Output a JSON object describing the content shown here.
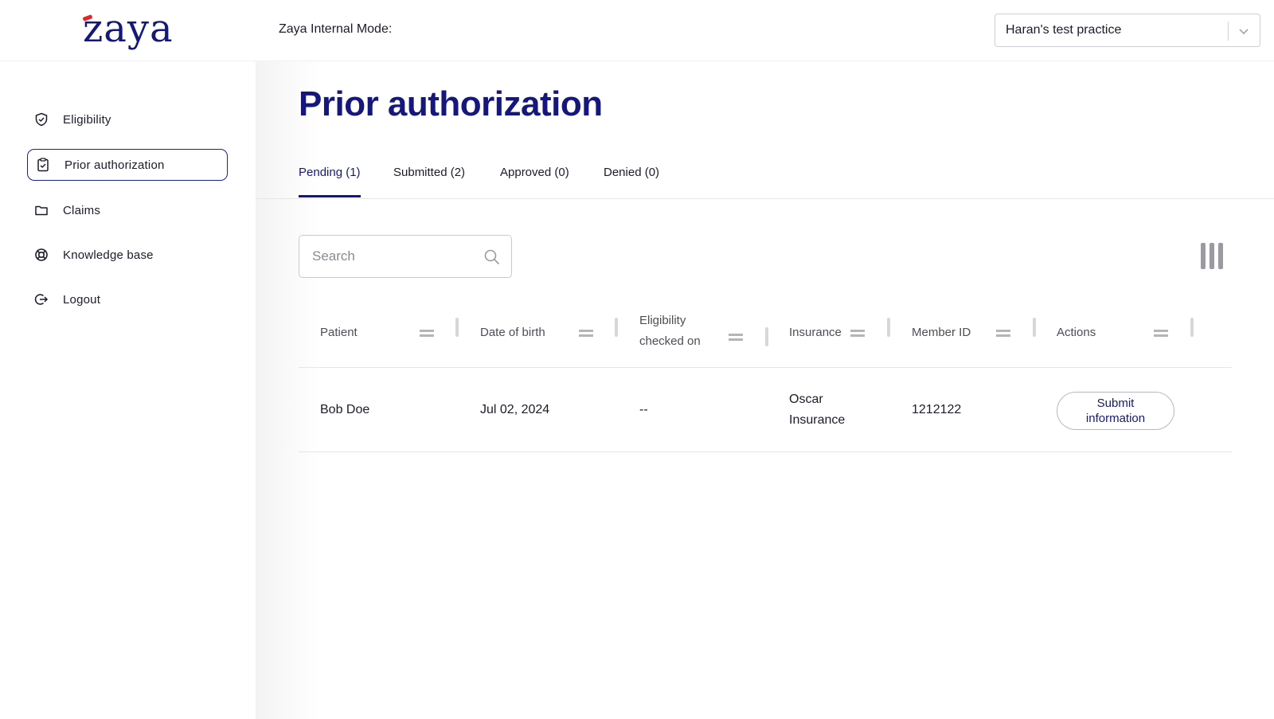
{
  "brand": {
    "logo_text": "zaya"
  },
  "sidebar": {
    "items": [
      {
        "label": "Eligibility",
        "icon": "shield-check-icon",
        "active": false
      },
      {
        "label": "Prior authorization",
        "icon": "clipboard-check-icon",
        "active": true
      },
      {
        "label": "Claims",
        "icon": "folder-icon",
        "active": false
      },
      {
        "label": "Knowledge base",
        "icon": "lifebuoy-icon",
        "active": false
      },
      {
        "label": "Logout",
        "icon": "logout-icon",
        "active": false
      }
    ]
  },
  "header": {
    "internal_mode_label": "Zaya Internal Mode:",
    "practice_select": {
      "value": "Haran's test practice",
      "icon": "chevron-down-icon"
    }
  },
  "page": {
    "title": "Prior authorization"
  },
  "tabs": [
    {
      "label": "Pending (1)",
      "active": true
    },
    {
      "label": "Submitted (2)",
      "active": false
    },
    {
      "label": "Approved (0)",
      "active": false
    },
    {
      "label": "Denied (0)",
      "active": false
    }
  ],
  "search": {
    "placeholder": "Search",
    "value": "",
    "icon": "search-icon"
  },
  "toolbar": {
    "columns_icon": "columns-icon"
  },
  "table": {
    "columns": [
      {
        "label": "Patient"
      },
      {
        "label": "Date of birth"
      },
      {
        "label": "Eligibility checked on",
        "line1": "Eligibility",
        "line2": "checked on"
      },
      {
        "label": "Insurance"
      },
      {
        "label": "Member ID"
      },
      {
        "label": "Actions"
      }
    ],
    "rows": [
      {
        "patient": "Bob Doe",
        "date_of_birth": "Jul 02, 2024",
        "eligibility_checked_on": "--",
        "insurance_line1": "Oscar",
        "insurance_line2": "Insurance",
        "member_id": "1212122",
        "action_line1": "Submit",
        "action_line2": "information"
      }
    ]
  },
  "colors": {
    "brand_navy": "#15187a",
    "accent_red": "#e0252d",
    "border_gray": "#c9c9cf"
  }
}
